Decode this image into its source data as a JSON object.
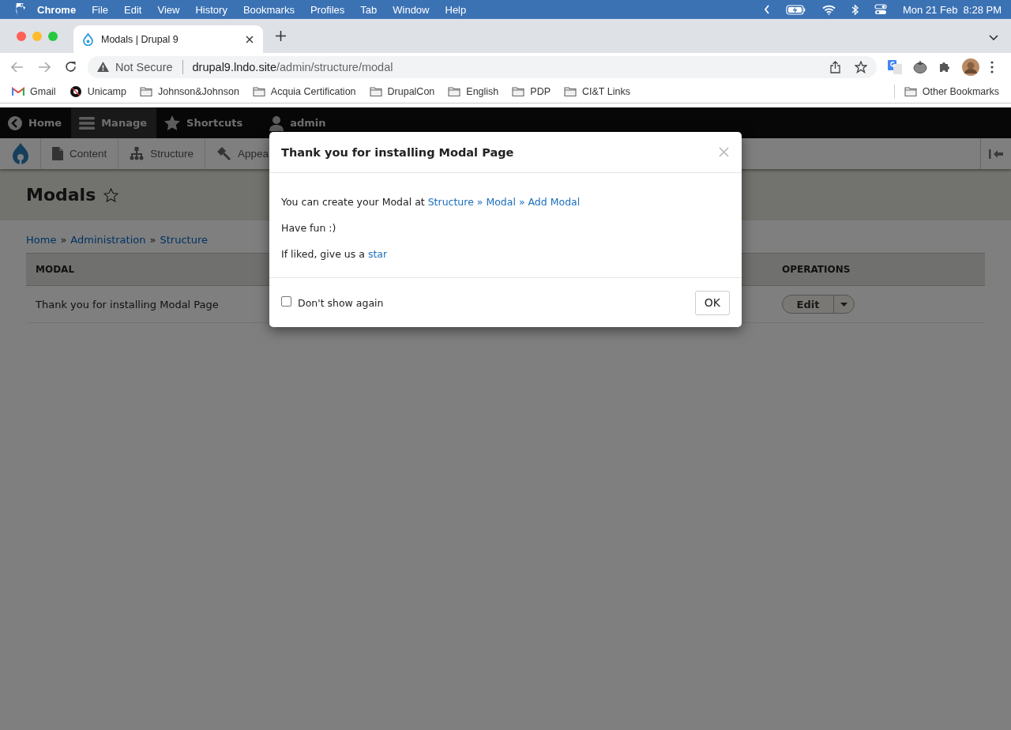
{
  "menubar": {
    "app": "Chrome",
    "menus": [
      "File",
      "Edit",
      "View",
      "History",
      "Bookmarks",
      "Profiles",
      "Tab",
      "Window",
      "Help"
    ],
    "clock": "Mon 21 Feb  8:28 PM"
  },
  "browser": {
    "tab": {
      "title": "Modals | Drupal 9"
    },
    "address": {
      "security": "Not Secure",
      "host": "drupal9.lndo.site",
      "path": "/admin/structure/modal"
    },
    "bookmarks": [
      {
        "label": "Gmail",
        "kind": "gmail"
      },
      {
        "label": "Unicamp",
        "kind": "site"
      },
      {
        "label": "Johnson&Johnson",
        "kind": "folder"
      },
      {
        "label": "Acquia Certification",
        "kind": "folder"
      },
      {
        "label": "DrupalCon",
        "kind": "folder"
      },
      {
        "label": "English",
        "kind": "folder"
      },
      {
        "label": "PDP",
        "kind": "folder"
      },
      {
        "label": "CI&T Links",
        "kind": "folder"
      }
    ],
    "other_bookmarks": "Other Bookmarks"
  },
  "toolbar": {
    "items": [
      {
        "label": "Home",
        "kind": "back",
        "selected": false
      },
      {
        "label": "Manage",
        "kind": "menu",
        "selected": true
      },
      {
        "label": "Shortcuts",
        "kind": "star",
        "selected": false
      },
      {
        "label": "admin",
        "kind": "user",
        "selected": false
      }
    ]
  },
  "tray": [
    {
      "label": "Content",
      "kind": "page"
    },
    {
      "label": "Structure",
      "kind": "tree"
    },
    {
      "label": "Appea",
      "kind": "brush"
    }
  ],
  "page": {
    "title": "Modals",
    "breadcrumb": {
      "items": [
        "Home",
        "Administration",
        "Structure"
      ],
      "separator": "»"
    },
    "table": {
      "columns": [
        "MODAL",
        "OPERATIONS"
      ],
      "rows": [
        {
          "modal": "Thank you for installing Modal Page",
          "operation": "Edit"
        }
      ]
    }
  },
  "modal": {
    "title": "Thank you for installing Modal Page",
    "paragraphs": [
      {
        "text": "You can create your Modal at ",
        "link": "Structure » Modal » Add Modal"
      },
      {
        "text": "Have fun :)"
      },
      {
        "text": "If liked, give us a ",
        "link": "star"
      }
    ],
    "checkbox": {
      "label": "Don't show again",
      "checked": false
    },
    "button": "OK"
  }
}
